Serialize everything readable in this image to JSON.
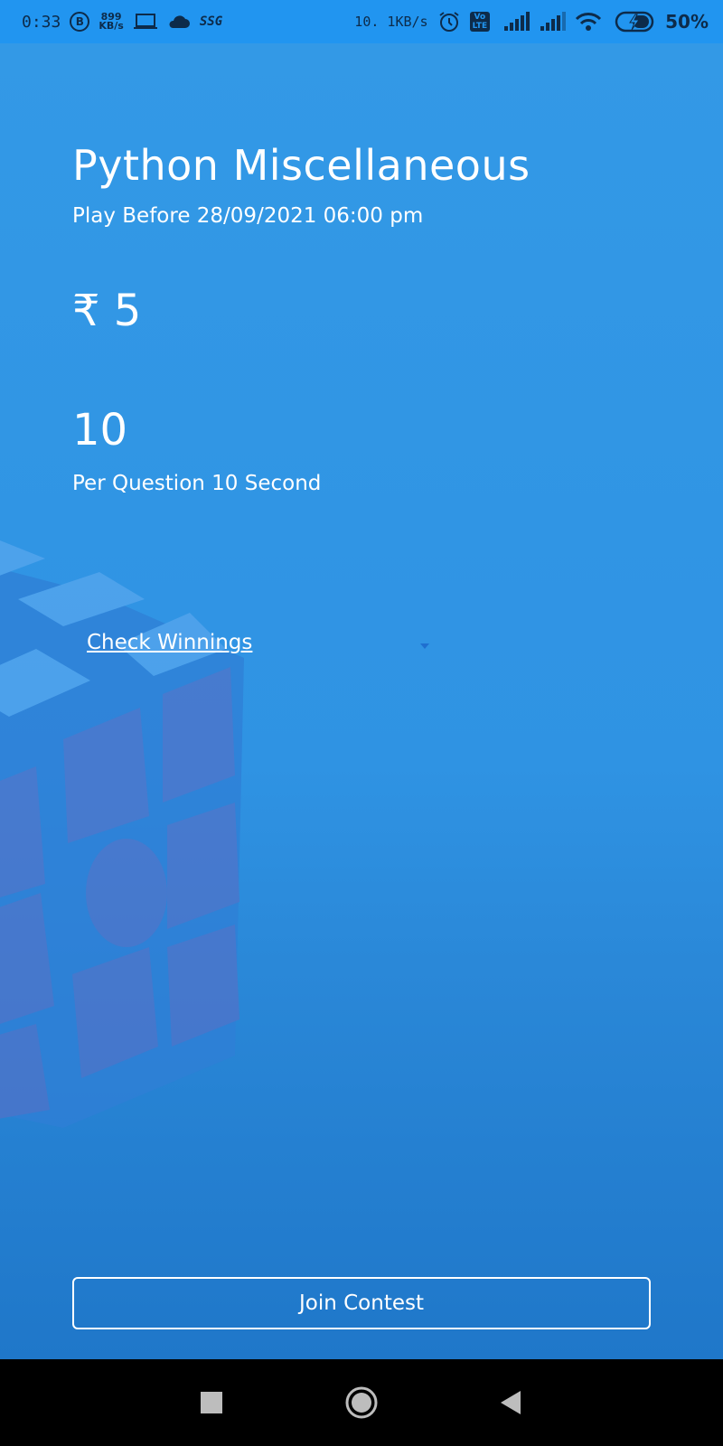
{
  "status_bar": {
    "time": "0:33",
    "b_badge": "B",
    "net_speed_value": "899",
    "net_speed_unit": "KB/s",
    "carrier_tag": "SSG",
    "right_speed": "10. 1KB/s",
    "volte_top": "Vo",
    "volte_bottom": "LTE",
    "battery_percent": "50%"
  },
  "contest": {
    "title": "Python Miscellaneous",
    "play_before": "Play Before 28/09/2021 06:00 pm",
    "entry_fee": "₹ 5",
    "question_count": "10",
    "per_question": "Per Question 10 Second",
    "check_winnings_label": "Check Winnings",
    "join_label": "Join Contest"
  },
  "colors": {
    "status_bar_bg": "#2195f0",
    "background_blue": "#2f93e3",
    "cube_face": "#4f74c9",
    "cube_top": "#56a6ee",
    "nav_bar_bg": "#000000"
  },
  "icons": {
    "status_left": [
      "b-badge-icon",
      "laptop-icon",
      "cloud-icon"
    ],
    "status_right": [
      "alarm-icon",
      "volte-icon",
      "signal-icon",
      "signal-icon",
      "wifi-icon",
      "battery-charging-icon"
    ],
    "nav": [
      "recents-square-icon",
      "home-circle-icon",
      "back-triangle-icon"
    ]
  }
}
